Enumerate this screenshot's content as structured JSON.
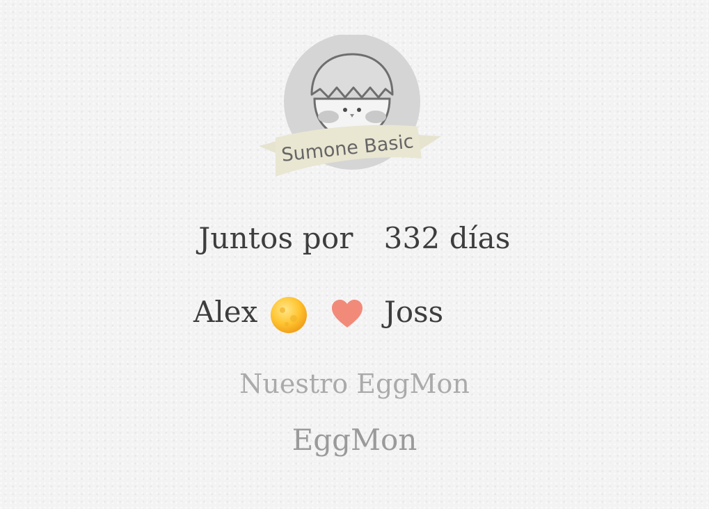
{
  "badge": {
    "logo_text": "Sumone Basic",
    "icon": "egg-chick-icon"
  },
  "together": {
    "label": "Juntos por",
    "days": "332 días"
  },
  "couple": {
    "name1": "Alex",
    "name1_emoji_icon": "moon-emoji-icon",
    "heart_icon": "heart-icon",
    "heart_color": "#f28a7a",
    "name2": "Joss"
  },
  "eggmon": {
    "label": "Nuestro EggMon",
    "name": "EggMon"
  }
}
